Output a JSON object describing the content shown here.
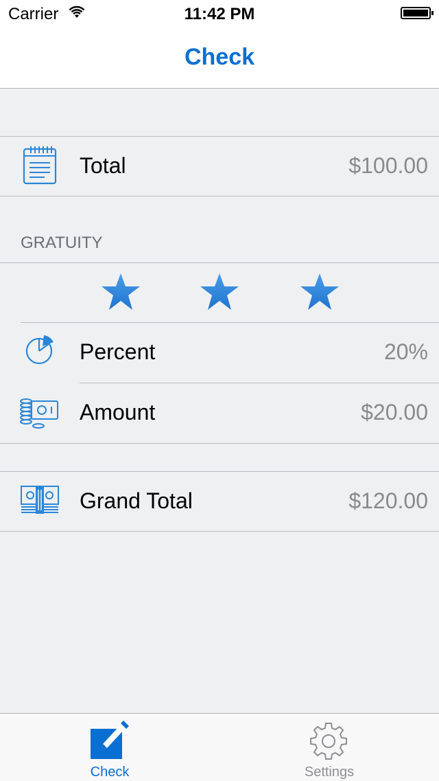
{
  "status_bar": {
    "carrier": "Carrier",
    "time": "11:42 PM"
  },
  "nav": {
    "title": "Check"
  },
  "total_row": {
    "label": "Total",
    "value": "$100.00",
    "icon": "notepad-icon"
  },
  "gratuity": {
    "header": "GRATUITY",
    "rating": {
      "stars_filled": 3,
      "stars_total": 3
    },
    "percent": {
      "label": "Percent",
      "value": "20%",
      "icon": "pie-chart-icon"
    },
    "amount": {
      "label": "Amount",
      "value": "$20.00",
      "icon": "coins-cash-icon"
    }
  },
  "grand_total_row": {
    "label": "Grand Total",
    "value": "$120.00",
    "icon": "banknotes-icon"
  },
  "tab_bar": {
    "tabs": [
      {
        "label": "Check",
        "icon": "edit-pencil-icon",
        "selected": true
      },
      {
        "label": "Settings",
        "icon": "gear-icon",
        "selected": false
      }
    ]
  },
  "colors": {
    "accent": "#0a6fd2",
    "background": "#eef0f1",
    "value_text": "#8a8a8a",
    "inactive_tab": "#8e8e93"
  }
}
